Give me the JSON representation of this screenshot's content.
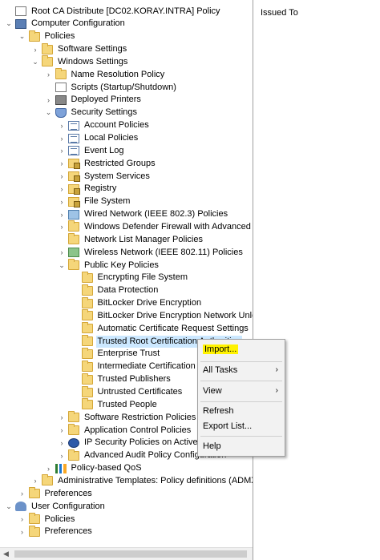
{
  "tree": [
    {
      "label": "Root CA Distribute [DC02.KORAY.INTRA] Policy",
      "depth": 0,
      "chev": "",
      "icon": "doc",
      "name": "root-policy-node"
    },
    {
      "label": "Computer Configuration",
      "depth": 0,
      "chev": "down",
      "icon": "computer",
      "name": "computer-configuration-node"
    },
    {
      "label": "Policies",
      "depth": 1,
      "chev": "down",
      "icon": "folder",
      "name": "policies-node"
    },
    {
      "label": "Software Settings",
      "depth": 2,
      "chev": "right",
      "icon": "folder",
      "name": "software-settings-node"
    },
    {
      "label": "Windows Settings",
      "depth": 2,
      "chev": "down",
      "icon": "folder",
      "name": "windows-settings-node"
    },
    {
      "label": "Name Resolution Policy",
      "depth": 3,
      "chev": "right",
      "icon": "folder",
      "name": "name-resolution-policy-node"
    },
    {
      "label": "Scripts (Startup/Shutdown)",
      "depth": 3,
      "chev": "",
      "icon": "doc",
      "name": "scripts-node"
    },
    {
      "label": "Deployed Printers",
      "depth": 3,
      "chev": "right",
      "icon": "printer",
      "name": "deployed-printers-node"
    },
    {
      "label": "Security Settings",
      "depth": 3,
      "chev": "down",
      "icon": "shield",
      "name": "security-settings-node"
    },
    {
      "label": "Account Policies",
      "depth": 4,
      "chev": "right",
      "icon": "policy",
      "name": "account-policies-node"
    },
    {
      "label": "Local Policies",
      "depth": 4,
      "chev": "right",
      "icon": "policy",
      "name": "local-policies-node"
    },
    {
      "label": "Event Log",
      "depth": 4,
      "chev": "right",
      "icon": "policy",
      "name": "event-log-node"
    },
    {
      "label": "Restricted Groups",
      "depth": 4,
      "chev": "right",
      "icon": "lockfolder",
      "name": "restricted-groups-node"
    },
    {
      "label": "System Services",
      "depth": 4,
      "chev": "right",
      "icon": "lockfolder",
      "name": "system-services-node"
    },
    {
      "label": "Registry",
      "depth": 4,
      "chev": "right",
      "icon": "lockfolder",
      "name": "registry-node"
    },
    {
      "label": "File System",
      "depth": 4,
      "chev": "right",
      "icon": "lockfolder",
      "name": "file-system-node"
    },
    {
      "label": "Wired Network (IEEE 802.3) Policies",
      "depth": 4,
      "chev": "right",
      "icon": "network",
      "name": "wired-network-node"
    },
    {
      "label": "Windows Defender Firewall with Advanced S",
      "depth": 4,
      "chev": "right",
      "icon": "folder",
      "name": "firewall-node"
    },
    {
      "label": "Network List Manager Policies",
      "depth": 4,
      "chev": "",
      "icon": "folder",
      "name": "network-list-manager-node"
    },
    {
      "label": "Wireless Network (IEEE 802.11) Policies",
      "depth": 4,
      "chev": "right",
      "icon": "wifi",
      "name": "wireless-network-node"
    },
    {
      "label": "Public Key Policies",
      "depth": 4,
      "chev": "down",
      "icon": "folder",
      "name": "public-key-policies-node"
    },
    {
      "label": "Encrypting File System",
      "depth": 5,
      "chev": "",
      "icon": "folder",
      "name": "encrypting-file-system-node"
    },
    {
      "label": "Data Protection",
      "depth": 5,
      "chev": "",
      "icon": "folder",
      "name": "data-protection-node"
    },
    {
      "label": "BitLocker Drive Encryption",
      "depth": 5,
      "chev": "",
      "icon": "folder",
      "name": "bitlocker-node"
    },
    {
      "label": "BitLocker Drive Encryption Network Unlo",
      "depth": 5,
      "chev": "",
      "icon": "folder",
      "name": "bitlocker-network-unlock-node"
    },
    {
      "label": "Automatic Certificate Request Settings",
      "depth": 5,
      "chev": "",
      "icon": "folder",
      "name": "auto-cert-request-node"
    },
    {
      "label": "Trusted Root Certification Authorities",
      "depth": 5,
      "chev": "",
      "icon": "folder",
      "name": "trusted-root-ca-node",
      "selected": true
    },
    {
      "label": "Enterprise Trust",
      "depth": 5,
      "chev": "",
      "icon": "folder",
      "name": "enterprise-trust-node"
    },
    {
      "label": "Intermediate Certification Authorities",
      "depth": 5,
      "chev": "",
      "icon": "folder",
      "name": "intermediate-ca-node"
    },
    {
      "label": "Trusted Publishers",
      "depth": 5,
      "chev": "",
      "icon": "folder",
      "name": "trusted-publishers-node"
    },
    {
      "label": "Untrusted Certificates",
      "depth": 5,
      "chev": "",
      "icon": "folder",
      "name": "untrusted-certificates-node"
    },
    {
      "label": "Trusted People",
      "depth": 5,
      "chev": "",
      "icon": "folder",
      "name": "trusted-people-node"
    },
    {
      "label": "Software Restriction Policies",
      "depth": 4,
      "chev": "right",
      "icon": "folder",
      "name": "software-restriction-node"
    },
    {
      "label": "Application Control Policies",
      "depth": 4,
      "chev": "right",
      "icon": "folder",
      "name": "application-control-node"
    },
    {
      "label": "IP Security Policies on Active Directory",
      "depth": 4,
      "chev": "right",
      "icon": "ipsec",
      "name": "ip-security-node"
    },
    {
      "label": "Advanced Audit Policy Configuration",
      "depth": 4,
      "chev": "right",
      "icon": "folder",
      "name": "advanced-audit-node"
    },
    {
      "label": "Policy-based QoS",
      "depth": 3,
      "chev": "right",
      "icon": "chart",
      "name": "policy-based-qos-node"
    },
    {
      "label": "Administrative Templates: Policy definitions (ADMX",
      "depth": 2,
      "chev": "right",
      "icon": "folder",
      "name": "admin-templates-node"
    },
    {
      "label": "Preferences",
      "depth": 1,
      "chev": "right",
      "icon": "folder",
      "name": "computer-preferences-node"
    },
    {
      "label": "User Configuration",
      "depth": 0,
      "chev": "down",
      "icon": "user",
      "name": "user-configuration-node"
    },
    {
      "label": "Policies",
      "depth": 1,
      "chev": "right",
      "icon": "folder",
      "name": "user-policies-node"
    },
    {
      "label": "Preferences",
      "depth": 1,
      "chev": "right",
      "icon": "folder",
      "name": "user-preferences-node"
    }
  ],
  "list_pane": {
    "column_header": "Issued To"
  },
  "context_menu": {
    "import": "Import...",
    "all_tasks": "All Tasks",
    "view": "View",
    "refresh": "Refresh",
    "export_list": "Export List...",
    "help": "Help",
    "highlight_color": "#fff200"
  }
}
